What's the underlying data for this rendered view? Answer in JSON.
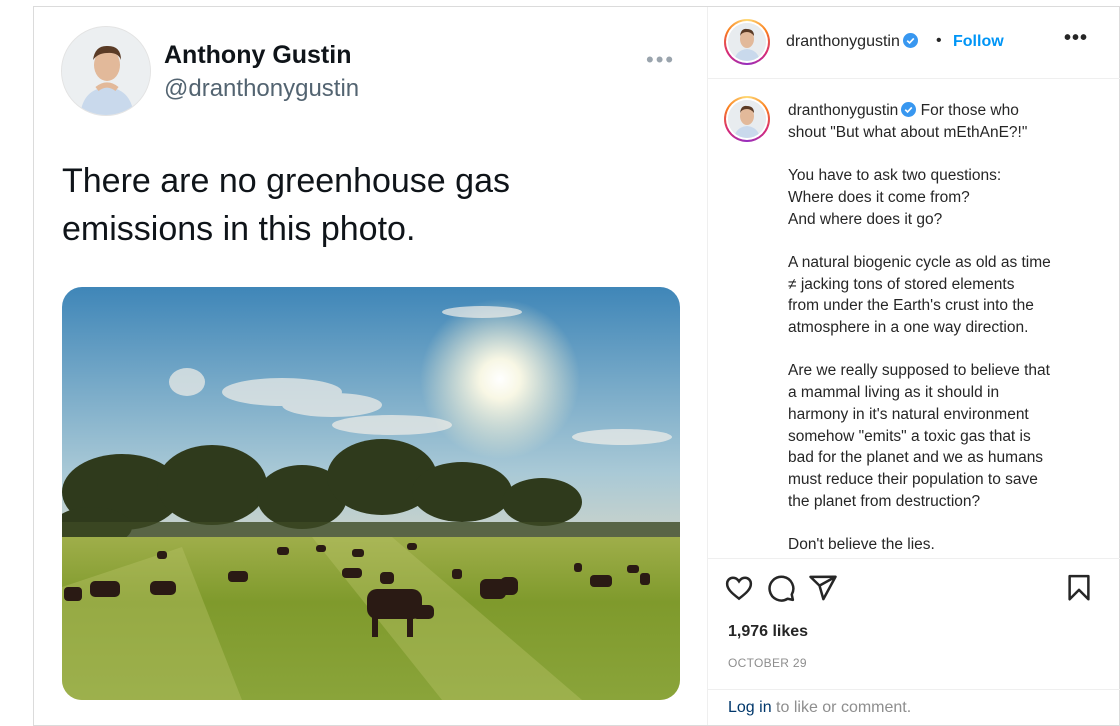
{
  "tweet": {
    "name": "Anthony Gustin",
    "handle": "@dranthonygustin",
    "text": "There are no greenhouse gas emissions in this photo."
  },
  "post": {
    "username": "dranthonygustin",
    "dot": "•",
    "follow_label": "Follow",
    "caption_first_line": "For those who",
    "caption_rest": "shout \"But what about mEthAnE?!\"\n\nYou have to ask two questions:\nWhere does it come from?\nAnd where does it go?\n\nA natural biogenic cycle as old as time\n≠ jacking tons of stored elements\nfrom under the Earth's crust into the\natmosphere in a one way direction.\n\nAre we really supposed to believe that\na mammal living as it should in\nharmony in it's natural environment\nsomehow \"emits\" a toxic gas that is\nbad for the planet and we as humans\nmust reduce their population to save\nthe planet from destruction?\n\nDon't believe the lies.",
    "likes": "1,976 likes",
    "date": "OCTOBER 29",
    "login_link": "Log in",
    "login_rest": " to like or comment."
  },
  "icons": {
    "like": "heart-icon",
    "comment": "comment-icon",
    "share": "share-icon",
    "save": "bookmark-icon",
    "verified": "verified-badge-icon",
    "more": "more-options-icon"
  },
  "colors": {
    "accent": "#0095f6",
    "verified": "#3897f0",
    "text": "#262626",
    "muted": "#8e8e8e"
  }
}
